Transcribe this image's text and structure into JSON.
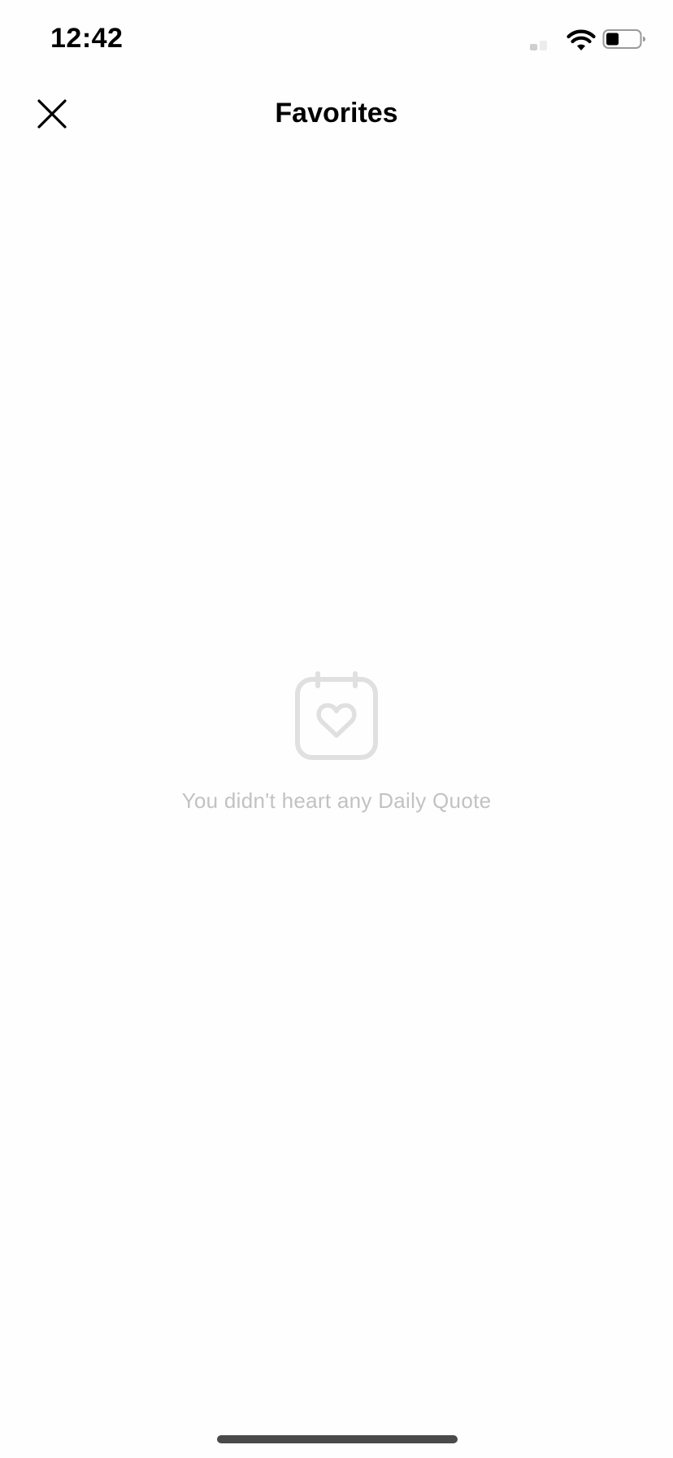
{
  "status_bar": {
    "time": "12:42",
    "icons": [
      "signal-icon",
      "wifi-icon",
      "battery-icon"
    ]
  },
  "nav": {
    "title": "Favorites",
    "close_icon": "close-icon"
  },
  "empty_state": {
    "icon": "calendar-heart-icon",
    "message": "You didn't heart any Daily Quote"
  },
  "colors": {
    "background": "#fefefe",
    "text_primary": "#000000",
    "empty_text": "#c2c2c2",
    "empty_icon": "#e0e0e0",
    "home_indicator": "#4a4a4a"
  }
}
